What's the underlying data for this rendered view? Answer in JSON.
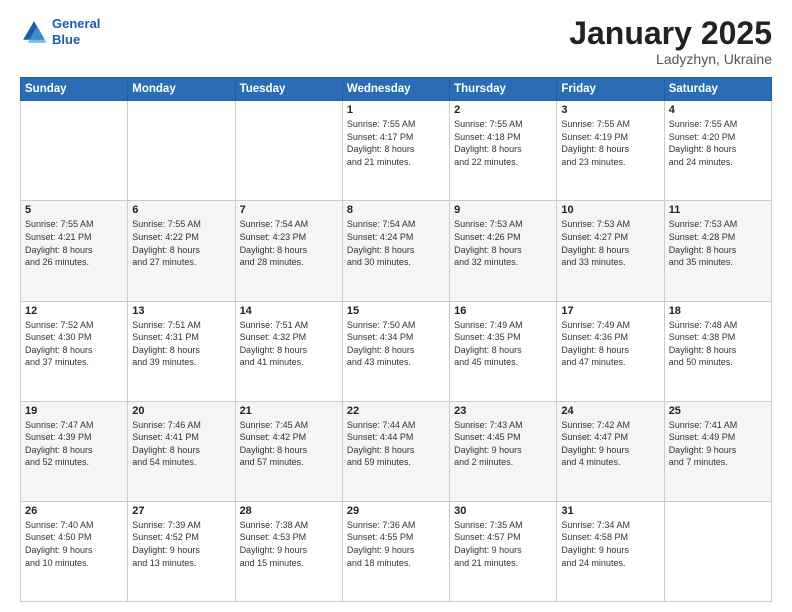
{
  "header": {
    "logo_line1": "General",
    "logo_line2": "Blue",
    "month": "January 2025",
    "location": "Ladyzhyn, Ukraine"
  },
  "weekdays": [
    "Sunday",
    "Monday",
    "Tuesday",
    "Wednesday",
    "Thursday",
    "Friday",
    "Saturday"
  ],
  "weeks": [
    [
      {
        "day": "",
        "info": ""
      },
      {
        "day": "",
        "info": ""
      },
      {
        "day": "",
        "info": ""
      },
      {
        "day": "1",
        "info": "Sunrise: 7:55 AM\nSunset: 4:17 PM\nDaylight: 8 hours\nand 21 minutes."
      },
      {
        "day": "2",
        "info": "Sunrise: 7:55 AM\nSunset: 4:18 PM\nDaylight: 8 hours\nand 22 minutes."
      },
      {
        "day": "3",
        "info": "Sunrise: 7:55 AM\nSunset: 4:19 PM\nDaylight: 8 hours\nand 23 minutes."
      },
      {
        "day": "4",
        "info": "Sunrise: 7:55 AM\nSunset: 4:20 PM\nDaylight: 8 hours\nand 24 minutes."
      }
    ],
    [
      {
        "day": "5",
        "info": "Sunrise: 7:55 AM\nSunset: 4:21 PM\nDaylight: 8 hours\nand 26 minutes."
      },
      {
        "day": "6",
        "info": "Sunrise: 7:55 AM\nSunset: 4:22 PM\nDaylight: 8 hours\nand 27 minutes."
      },
      {
        "day": "7",
        "info": "Sunrise: 7:54 AM\nSunset: 4:23 PM\nDaylight: 8 hours\nand 28 minutes."
      },
      {
        "day": "8",
        "info": "Sunrise: 7:54 AM\nSunset: 4:24 PM\nDaylight: 8 hours\nand 30 minutes."
      },
      {
        "day": "9",
        "info": "Sunrise: 7:53 AM\nSunset: 4:26 PM\nDaylight: 8 hours\nand 32 minutes."
      },
      {
        "day": "10",
        "info": "Sunrise: 7:53 AM\nSunset: 4:27 PM\nDaylight: 8 hours\nand 33 minutes."
      },
      {
        "day": "11",
        "info": "Sunrise: 7:53 AM\nSunset: 4:28 PM\nDaylight: 8 hours\nand 35 minutes."
      }
    ],
    [
      {
        "day": "12",
        "info": "Sunrise: 7:52 AM\nSunset: 4:30 PM\nDaylight: 8 hours\nand 37 minutes."
      },
      {
        "day": "13",
        "info": "Sunrise: 7:51 AM\nSunset: 4:31 PM\nDaylight: 8 hours\nand 39 minutes."
      },
      {
        "day": "14",
        "info": "Sunrise: 7:51 AM\nSunset: 4:32 PM\nDaylight: 8 hours\nand 41 minutes."
      },
      {
        "day": "15",
        "info": "Sunrise: 7:50 AM\nSunset: 4:34 PM\nDaylight: 8 hours\nand 43 minutes."
      },
      {
        "day": "16",
        "info": "Sunrise: 7:49 AM\nSunset: 4:35 PM\nDaylight: 8 hours\nand 45 minutes."
      },
      {
        "day": "17",
        "info": "Sunrise: 7:49 AM\nSunset: 4:36 PM\nDaylight: 8 hours\nand 47 minutes."
      },
      {
        "day": "18",
        "info": "Sunrise: 7:48 AM\nSunset: 4:38 PM\nDaylight: 8 hours\nand 50 minutes."
      }
    ],
    [
      {
        "day": "19",
        "info": "Sunrise: 7:47 AM\nSunset: 4:39 PM\nDaylight: 8 hours\nand 52 minutes."
      },
      {
        "day": "20",
        "info": "Sunrise: 7:46 AM\nSunset: 4:41 PM\nDaylight: 8 hours\nand 54 minutes."
      },
      {
        "day": "21",
        "info": "Sunrise: 7:45 AM\nSunset: 4:42 PM\nDaylight: 8 hours\nand 57 minutes."
      },
      {
        "day": "22",
        "info": "Sunrise: 7:44 AM\nSunset: 4:44 PM\nDaylight: 8 hours\nand 59 minutes."
      },
      {
        "day": "23",
        "info": "Sunrise: 7:43 AM\nSunset: 4:45 PM\nDaylight: 9 hours\nand 2 minutes."
      },
      {
        "day": "24",
        "info": "Sunrise: 7:42 AM\nSunset: 4:47 PM\nDaylight: 9 hours\nand 4 minutes."
      },
      {
        "day": "25",
        "info": "Sunrise: 7:41 AM\nSunset: 4:49 PM\nDaylight: 9 hours\nand 7 minutes."
      }
    ],
    [
      {
        "day": "26",
        "info": "Sunrise: 7:40 AM\nSunset: 4:50 PM\nDaylight: 9 hours\nand 10 minutes."
      },
      {
        "day": "27",
        "info": "Sunrise: 7:39 AM\nSunset: 4:52 PM\nDaylight: 9 hours\nand 13 minutes."
      },
      {
        "day": "28",
        "info": "Sunrise: 7:38 AM\nSunset: 4:53 PM\nDaylight: 9 hours\nand 15 minutes."
      },
      {
        "day": "29",
        "info": "Sunrise: 7:36 AM\nSunset: 4:55 PM\nDaylight: 9 hours\nand 18 minutes."
      },
      {
        "day": "30",
        "info": "Sunrise: 7:35 AM\nSunset: 4:57 PM\nDaylight: 9 hours\nand 21 minutes."
      },
      {
        "day": "31",
        "info": "Sunrise: 7:34 AM\nSunset: 4:58 PM\nDaylight: 9 hours\nand 24 minutes."
      },
      {
        "day": "",
        "info": ""
      }
    ]
  ]
}
